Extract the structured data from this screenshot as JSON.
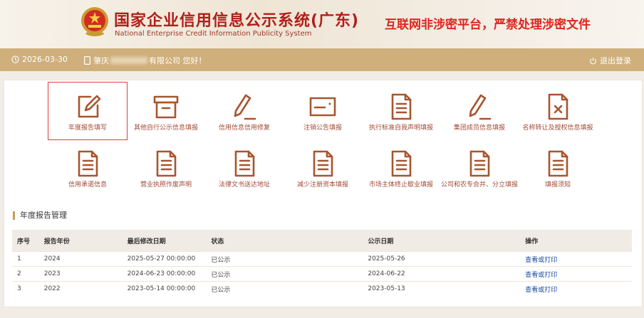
{
  "header": {
    "title": "国家企业信用信息公示系统(广东)",
    "subtitle": "National Enterprise Credit Information Publicity System",
    "warning": "互联网非涉密平台，严禁处理涉密文件",
    "emblem_icon": "national-emblem-icon"
  },
  "topbar": {
    "date": "2026-03-30",
    "greeting_prefix": "肇庆",
    "greeting_suffix": "有限公司 您好！",
    "logout": "退出登录"
  },
  "tiles": [
    {
      "label": "年度报告填写",
      "icon": "edit-icon",
      "selected": true
    },
    {
      "label": "其他自行公示信息填报",
      "icon": "archive-box-icon"
    },
    {
      "label": "信用信息信用修复",
      "icon": "pen-icon"
    },
    {
      "label": "注销公告填报",
      "icon": "card-icon"
    },
    {
      "label": "执行标准自我声明填报",
      "icon": "document-icon"
    },
    {
      "label": "集团成员信息填报",
      "icon": "pen-icon"
    },
    {
      "label": "名称转让及授权信息填报",
      "icon": "document-x-icon"
    },
    {
      "label": "信用承诺信息",
      "icon": "document-icon"
    },
    {
      "label": "营业执照作废声明",
      "icon": "document-icon"
    },
    {
      "label": "法律文书送达地址",
      "icon": "document-icon"
    },
    {
      "label": "减少注册资本填报",
      "icon": "document-icon"
    },
    {
      "label": "市场主体终止歇业填报",
      "icon": "document-icon"
    },
    {
      "label": "公司和农专合并、分立填报",
      "icon": "document-icon"
    },
    {
      "label": "填报须知",
      "icon": "document-icon"
    }
  ],
  "section": {
    "title": "年度报告管理"
  },
  "table": {
    "headers": [
      "序号",
      "报告年份",
      "最后修改日期",
      "状态",
      "公示日期",
      "操作"
    ],
    "rows": [
      [
        "1",
        "2024",
        "2025-05-27 00:00:00",
        "已公示",
        "2025-05-26",
        "查看或打印"
      ],
      [
        "2",
        "2023",
        "2024-06-23 00:00:00",
        "已公示",
        "2024-06-22",
        "查看或打印"
      ],
      [
        "3",
        "2022",
        "2023-05-14 00:00:00",
        "已公示",
        "2023-05-13",
        "查看或打印"
      ]
    ]
  },
  "colors": {
    "accent": "#cfb07b",
    "title_red": "#b01f1a",
    "warning_red": "#e0241f",
    "link": "#1a4a9a"
  }
}
